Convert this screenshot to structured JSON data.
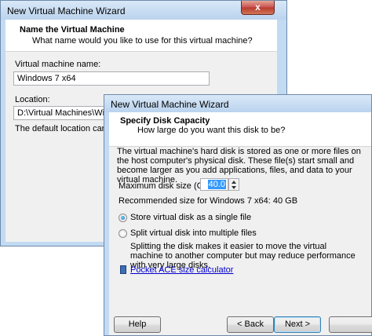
{
  "back_window": {
    "title": "New Virtual Machine Wizard",
    "close_glyph": "x",
    "header_title": "Name the Virtual Machine",
    "header_subtitle": "What name would you like to use for this virtual machine?",
    "vm_name_label": "Virtual machine name:",
    "vm_name_value": "Windows 7 x64",
    "location_label": "Location:",
    "location_value": "D:\\Virtual Machines\\Windows",
    "default_location_note": "The default location can be cha"
  },
  "front_window": {
    "title": "New Virtual Machine Wizard",
    "header_title": "Specify Disk Capacity",
    "header_subtitle": "How large do you want this disk to be?",
    "description": "The virtual machine's hard disk is stored as one or more files on the host computer's physical disk. These file(s) start small and become larger as you add applications, files, and data to your virtual machine.",
    "max_disk_label": "Maximum disk size (GB):",
    "max_disk_value": "40.0",
    "recommended": "Recommended size for Windows 7 x64: 40 GB",
    "option_single": "Store virtual disk as a single file",
    "option_split": "Split virtual disk into multiple files",
    "split_note": "Splitting the disk makes it easier to move the virtual machine to another computer but may reduce performance with very large disks.",
    "calc_link": "Pocket ACE size calculator",
    "help_button": "Help",
    "back_button": "< Back",
    "next_button": "Next >"
  },
  "colors": {
    "titlebar_blue": "#b9d3ee",
    "link": "#0000cc"
  }
}
